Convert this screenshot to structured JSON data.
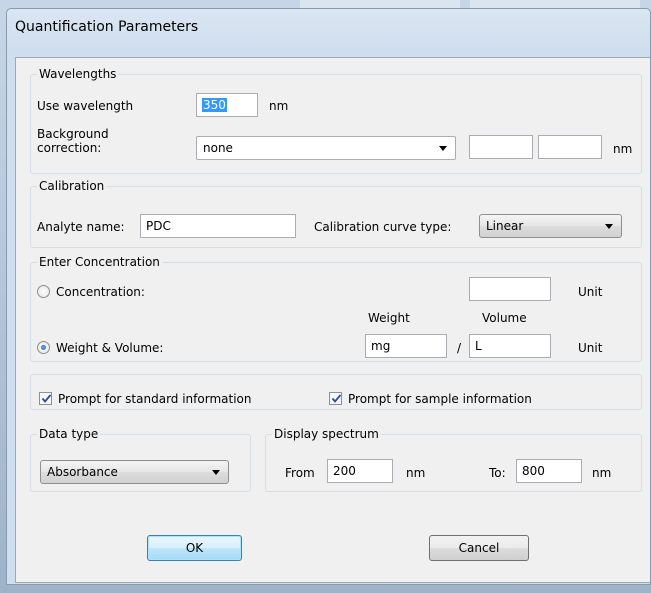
{
  "window": {
    "title": "Quantification Parameters"
  },
  "wavelengths": {
    "group_label": "Wavelengths",
    "use_wavelength_label": "Use wavelength",
    "use_wavelength_value": "350",
    "use_wavelength_unit": "nm",
    "background_correction_label_1": "Background",
    "background_correction_label_2": "correction:",
    "background_correction_value": "none",
    "background_field_1": "",
    "background_field_2": "",
    "background_unit": "nm"
  },
  "calibration": {
    "group_label": "Calibration",
    "analyte_name_label": "Analyte name:",
    "analyte_name_value": "PDC",
    "curve_type_label": "Calibration curve type:",
    "curve_type_value": "Linear"
  },
  "concentration": {
    "group_label": "Enter Concentration",
    "concentration_label": "Concentration:",
    "concentration_value": "",
    "concentration_unit": "Unit",
    "weight_volume_label": "Weight & Volume:",
    "weight_header": "Weight",
    "volume_header": "Volume",
    "weight_value": "mg",
    "separator": "/",
    "volume_value": "L",
    "weight_volume_unit": "Unit",
    "selected": "weight_volume"
  },
  "prompts": {
    "standard_label": "Prompt for standard information",
    "standard_checked": true,
    "sample_label": "Prompt for sample information",
    "sample_checked": true
  },
  "data_type": {
    "group_label": "Data type",
    "value": "Absorbance"
  },
  "display_spectrum": {
    "group_label": "Display spectrum",
    "from_label": "From",
    "from_value": "200",
    "from_unit": "nm",
    "to_label": "To:",
    "to_value": "800",
    "to_unit": "nm"
  },
  "buttons": {
    "ok": "OK",
    "cancel": "Cancel"
  }
}
